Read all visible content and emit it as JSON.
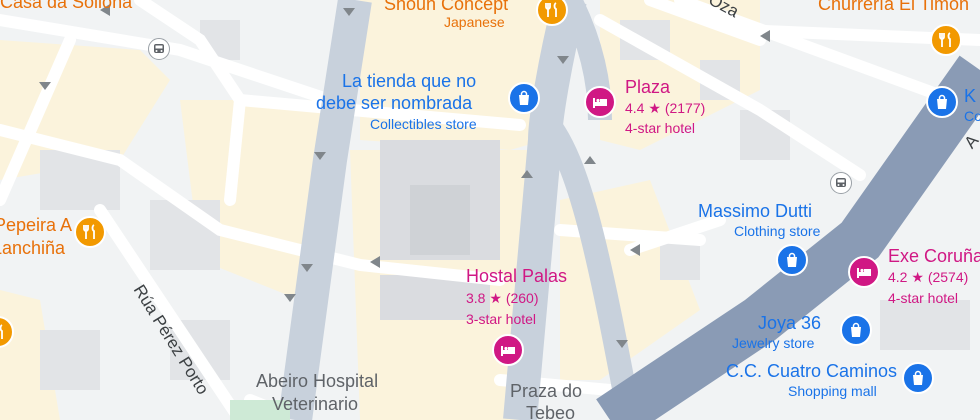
{
  "map": {
    "colors": {
      "land": "#f1f3f4",
      "block": "#e8eaed",
      "building": "#dadce0",
      "road": "#ffffff",
      "arterial": "#c8d1dc",
      "highway": "#8a9bb5",
      "sand": "#fbf3dc",
      "park": "#ceead6"
    },
    "streets": {
      "rua_perez_porto": "Rúa Pérez Porto",
      "oza_fragment": "Oza",
      "top_right_fragment": "A"
    },
    "places": {
      "casa_da_sollona": {
        "name": "Casa da Sollona",
        "icon": "restaurant-icon"
      },
      "shoun_concept": {
        "name": "Shoun Concept",
        "category": "Japanese",
        "icon": "restaurant-icon"
      },
      "churreria": {
        "name": "Churrería El Timón",
        "icon": "restaurant-icon"
      },
      "la_tienda": {
        "name_line1": "La tienda que no",
        "name_line2": "debe ser nombrada",
        "category": "Collectibles store",
        "icon": "shopping-bag-icon"
      },
      "plaza": {
        "name": "Plaza",
        "rating": "4.4",
        "reviews": "(2177)",
        "category": "4-star hotel",
        "icon": "hotel-icon"
      },
      "k_store": {
        "name": "K",
        "category": "Co",
        "icon": "shopping-bag-icon"
      },
      "pepeira": {
        "name_line1": "Pepeira A",
        "name_line2": "Lanchiña",
        "icon": "restaurant-icon"
      },
      "massimo_dutti": {
        "name": "Massimo Dutti",
        "category": "Clothing store",
        "icon": "shopping-bag-icon"
      },
      "exe_coruna": {
        "name": "Exe Coruña",
        "rating": "4.2",
        "reviews": "(2574)",
        "category": "4-star hotel",
        "icon": "hotel-icon"
      },
      "hostal_palas": {
        "name": "Hostal Palas",
        "rating": "3.8",
        "reviews": "(260)",
        "category": "3-star hotel",
        "icon": "hotel-icon"
      },
      "joya_36": {
        "name": "Joya 36",
        "category": "Jewelry store",
        "icon": "shopping-bag-icon"
      },
      "cc_cuatro_caminos": {
        "name": "C.C. Cuatro Caminos",
        "category": "Shopping mall",
        "icon": "shopping-bag-icon"
      },
      "abeiro": {
        "name_line1": "Abeiro Hospital",
        "name_line2": "Veterinario"
      },
      "praza_tebeo": {
        "name_line1": "Praza do",
        "name_line2": "Tebeo"
      }
    },
    "star": "★"
  }
}
